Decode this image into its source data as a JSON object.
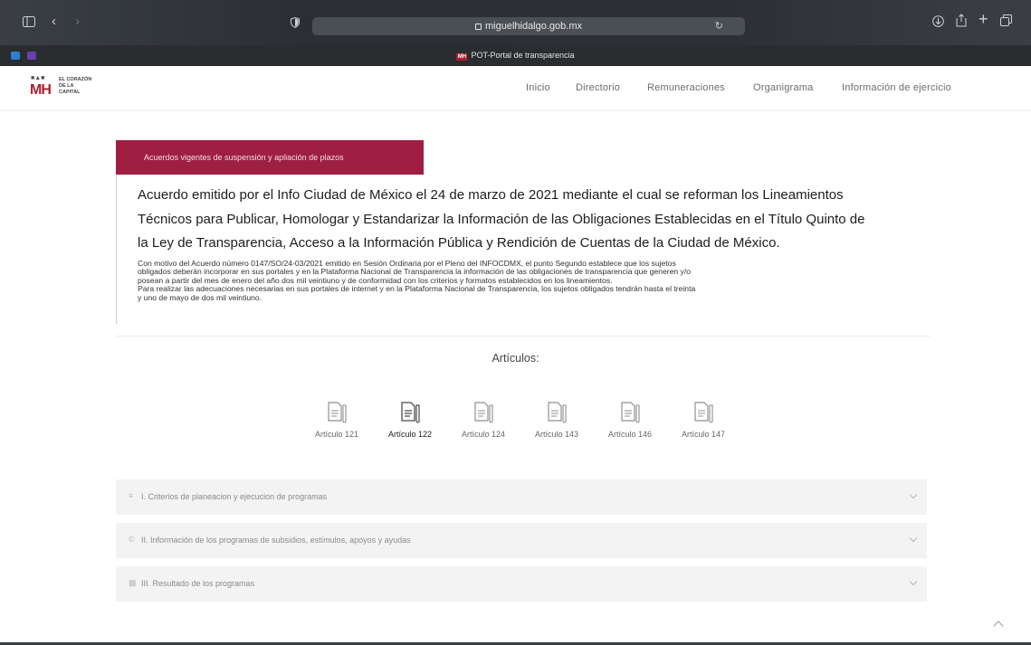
{
  "browser": {
    "url": "miguelhidalgo.gob.mx",
    "tab_title": "POT-Portal de transparencia"
  },
  "site": {
    "logo_text": [
      "EL CORAZÓN",
      "DE LA",
      "CAPITAL"
    ],
    "logo_mark": "MH",
    "brand_color": "#9e1f42",
    "nav": [
      "Inicio",
      "Directorio",
      "Remuneraciones",
      "Organigrama",
      "Información de ejercicio"
    ]
  },
  "main": {
    "banner": "Acuerdos vigentes de suspensión y apliación de plazos",
    "heading_lines": [
      "Acuerdo emitido por el Info Ciudad de México el 24 de marzo de 2021 mediante el cual se reforman los Lineamientos",
      "Técnicos para Publicar, Homologar y Estandarizar la Información de las Obligaciones Establecidas en el Título Quinto de",
      "la Ley de Transparencia, Acceso a la Información Pública y Rendición de Cuentas de la Ciudad de México."
    ],
    "paragraph_lines": [
      "Con motivo del Acuerdo número 0147/SO/24-03/2021 emitido en Sesión Ordinaria por el Pleno del INFOCDMX, el punto Segundo establece que los sujetos",
      "obligados deberán incorporar en sus portales y en la Plataforma Nacional de Transparencia la información de las obligaciones de transparencia que generen y/o",
      "posean a partir del mes de enero del año dos mil veintiuno y de conformidad con los criterios y formatos establecidos en los lineamientos.",
      "Para realizar las adecuaciones necesarias en sus portales de internet y en la Plataforma Nacional de Transparencia, los sujetos obligados tendrán hasta el treinta",
      "y uno de mayo de dos mil veintiuno."
    ],
    "articulos_title": "Artículos:",
    "articulos": [
      "Artículo 121",
      "Artículo 122",
      "Artículo 124",
      "Artículo 143",
      "Artículo 146",
      "Artículo 147"
    ],
    "active_articulo": "Artículo 122",
    "accordion": [
      {
        "icon": "list-icon",
        "label": "I. Criterios de planeacion y ejecucion de programas"
      },
      {
        "icon": "coin-icon",
        "label": "II. Información de los programas de subsidios, estímulos, apoyos y ayudas"
      },
      {
        "icon": "chart-icon",
        "label": "III. Resultado de los programas"
      }
    ]
  }
}
